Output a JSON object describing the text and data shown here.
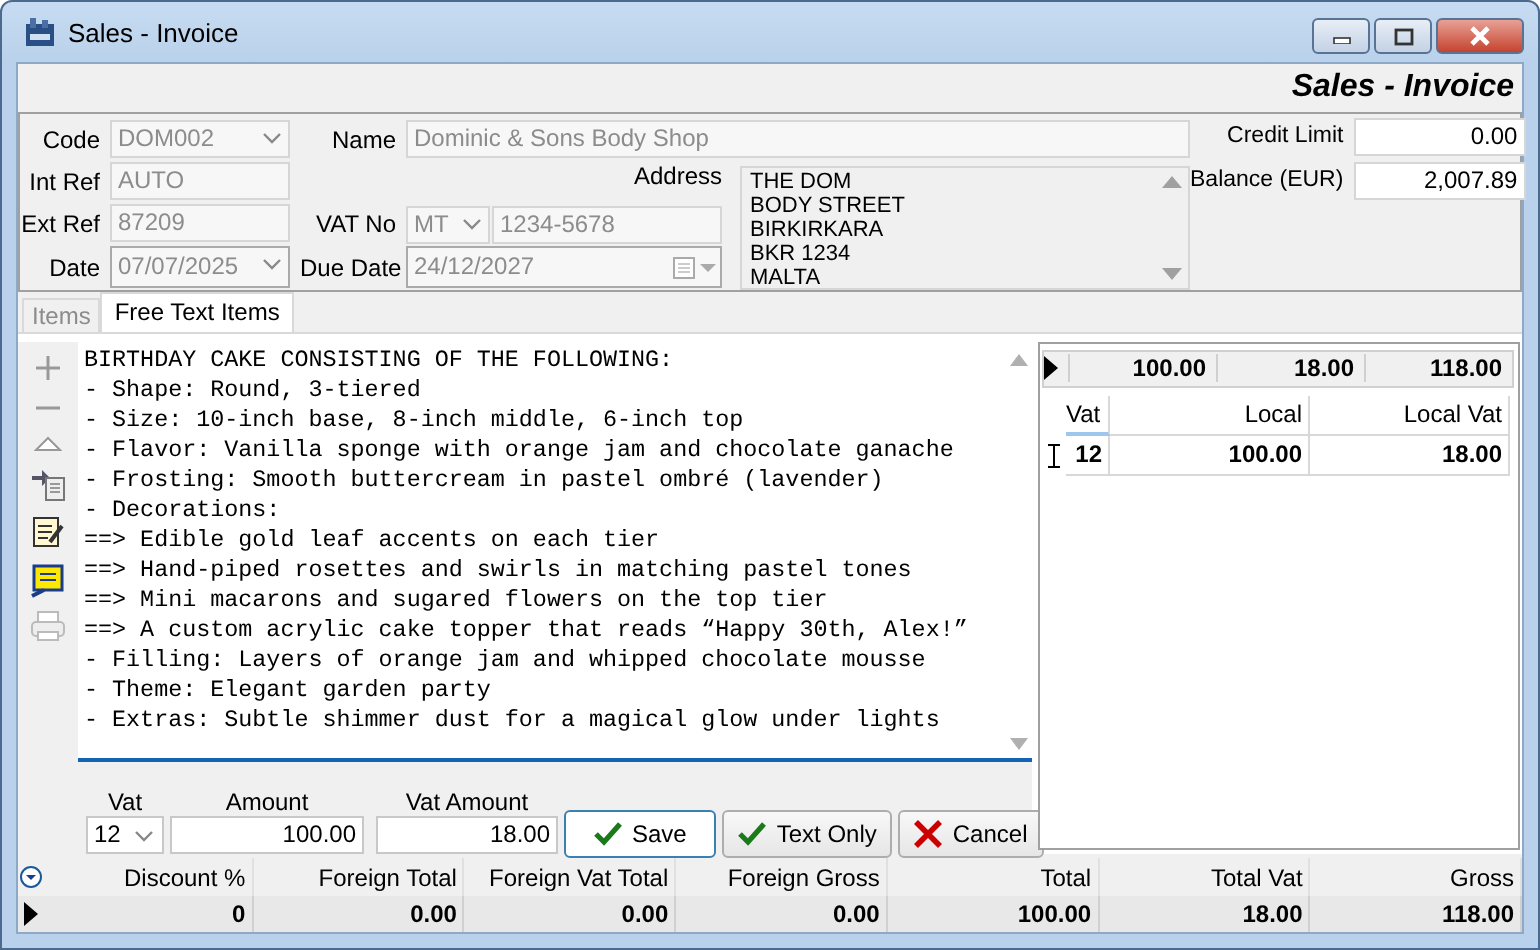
{
  "window": {
    "title": "Sales - Invoice"
  },
  "header_title": "Sales - Invoice",
  "form": {
    "code": {
      "label": "Code",
      "value": "DOM002",
      "disabled": true
    },
    "int_ref": {
      "label": "Int Ref",
      "value": "AUTO",
      "disabled": true
    },
    "ext_ref": {
      "label": "Ext Ref",
      "value": "87209",
      "disabled": true
    },
    "date": {
      "label": "Date",
      "value": "07/07/2025",
      "disabled": true
    },
    "name": {
      "label": "Name",
      "value": "Dominic & Sons Body Shop",
      "disabled": true
    },
    "vat_no": {
      "label": "VAT No",
      "country": "MT",
      "value": "1234-5678",
      "disabled": true
    },
    "due_date": {
      "label": "Due Date",
      "value": "24/12/2027",
      "disabled": true
    },
    "address": {
      "label": "Address",
      "lines": [
        "THE DOM",
        "BODY STREET",
        "BIRKIRKARA",
        "BKR 1234",
        "MALTA"
      ]
    },
    "credit_limit": {
      "label": "Credit Limit",
      "value": "0.00",
      "disabled": false
    },
    "balance": {
      "label": "Balance (EUR)",
      "value": "2,007.89",
      "disabled": false
    }
  },
  "tabs": [
    {
      "label": "Items",
      "selected": false
    },
    {
      "label": "Free Text Items",
      "selected": true
    }
  ],
  "editor": {
    "lines": [
      "BIRTHDAY CAKE CONSISTING OF THE FOLLOWING:",
      "- Shape: Round, 3-tiered",
      "- Size: 10-inch base, 8-inch middle, 6-inch top",
      "- Flavor: Vanilla sponge with orange jam and chocolate ganache",
      "- Frosting: Smooth buttercream in pastel ombré (lavender)",
      "- Decorations:",
      "==> Edible gold leaf accents on each tier",
      "==> Hand-piped rosettes and swirls in matching pastel tones",
      "==> Mini macarons and sugared flowers on the top tier",
      "==> A custom acrylic cake topper that reads “Happy 30th, Alex!”",
      "- Filling: Layers of orange jam and whipped chocolate mousse",
      "- Theme: Elegant garden party",
      "- Extras: Subtle shimmer dust for a magical glow under lights"
    ]
  },
  "entry": {
    "vat": {
      "label": "Vat",
      "value": "12"
    },
    "amount": {
      "label": "Amount",
      "value": "100.00"
    },
    "vat_amount": {
      "label": "Vat Amount",
      "value": "18.00"
    },
    "buttons": [
      {
        "label": "Save",
        "kind": "save"
      },
      {
        "label": "Text Only",
        "kind": "text_only"
      },
      {
        "label": "Cancel",
        "kind": "cancel"
      }
    ]
  },
  "vat_summary": {
    "totals": [
      "100.00",
      "18.00",
      "118.00"
    ],
    "columns": [
      "Vat",
      "Local",
      "Local Vat"
    ],
    "rows": [
      [
        "12",
        "100.00",
        "18.00"
      ]
    ]
  },
  "totals": {
    "columns": [
      "Discount %",
      "Foreign Total",
      "Foreign Vat Total",
      "Foreign Gross",
      "Total",
      "Total Vat",
      "Gross"
    ],
    "values": [
      "0",
      "0.00",
      "0.00",
      "0.00",
      "100.00",
      "18.00",
      "118.00"
    ]
  }
}
